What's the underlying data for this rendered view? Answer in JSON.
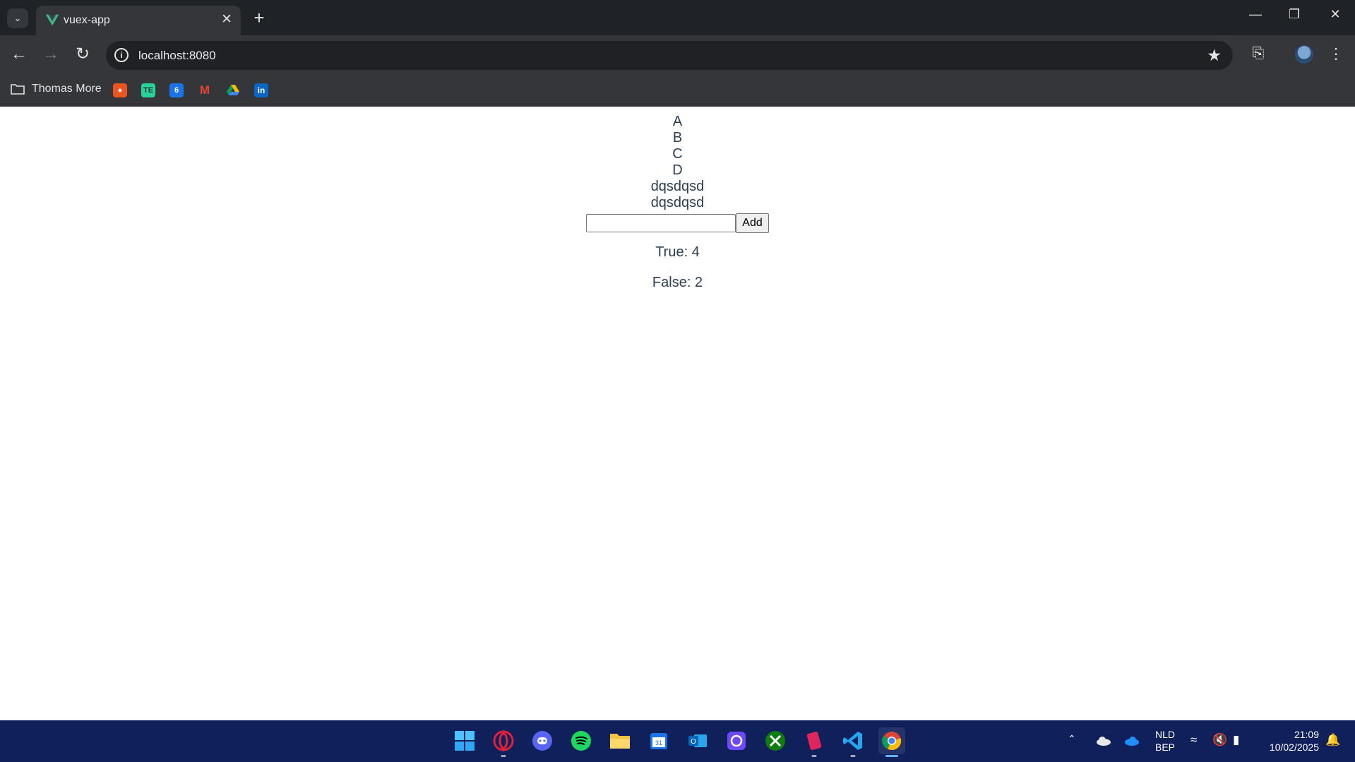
{
  "browser": {
    "tab_title": "vuex-app",
    "url": "localhost:8080",
    "bookmarks_folder": "Thomas More"
  },
  "app": {
    "items": [
      "A",
      "B",
      "C",
      "D",
      "dqsdqsd",
      "dqsdqsd"
    ],
    "input_value": "",
    "add_label": "Add",
    "true_count": "True: 4",
    "false_count": "False: 2"
  },
  "taskbar": {
    "lang_top": "NLD",
    "lang_bottom": "BEP",
    "time": "21:09",
    "date": "10/02/2025"
  },
  "colors": {
    "vue_green": "#42b883",
    "text": "#2c3e50",
    "taskbar": "#10205a"
  }
}
